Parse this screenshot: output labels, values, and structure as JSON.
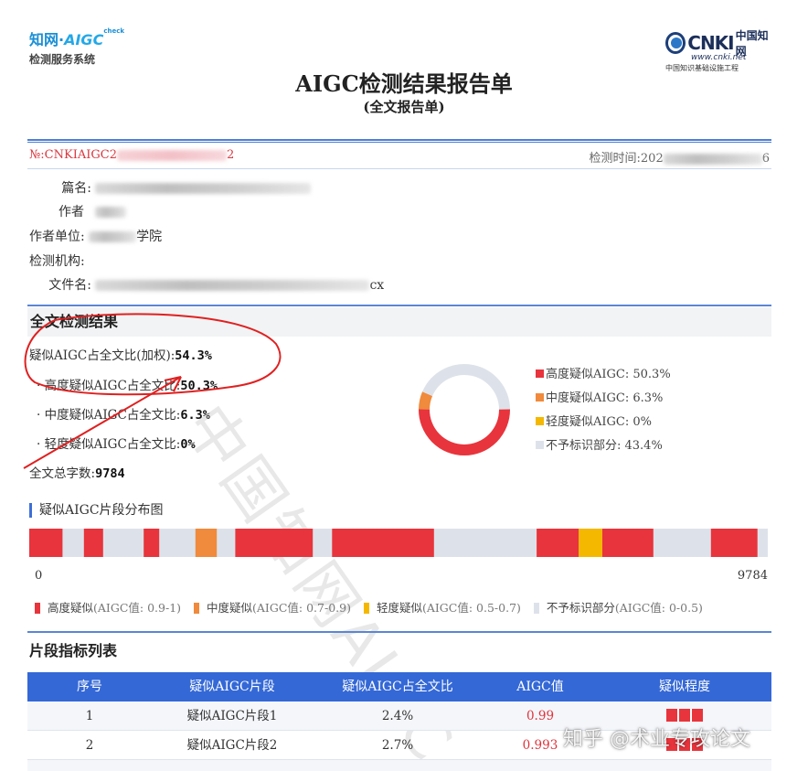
{
  "header": {
    "logo_left_line1_a": "知网·",
    "logo_left_line1_b": "AIGC",
    "logo_left_line1_sup": "check",
    "logo_left_line2": "检测服务系统",
    "logo_right_brand": "CNKI",
    "logo_right_cn": "中国知网",
    "logo_right_url": "www.cnki.net",
    "logo_right_sub": "中国知识基础设施工程",
    "title": "AIGC检测结果报告单",
    "subtitle": "(全文报告单)"
  },
  "meta": {
    "report_no_prefix": "№:CNKIAIGC2",
    "report_no_suffix": "2",
    "time_label": "检测时间:202",
    "time_suffix": "6"
  },
  "info": {
    "title_label": "篇名:",
    "author_label": "作者",
    "unit_label": "作者单位:",
    "unit_value_visible": "学院",
    "org_label": "检测机构:",
    "file_label": "文件名:",
    "file_value_visible": "cx"
  },
  "result": {
    "section_title": "全文检测结果",
    "weighted_label": "疑似AIGC占全文比(加权):",
    "weighted_value": "54.3%",
    "high_label": "· 高度疑似AIGC占全文比:",
    "high_value": "50.3%",
    "mid_label": "· 中度疑似AIGC占全文比:",
    "mid_value": "6.3%",
    "low_label": "· 轻度疑似AIGC占全文比:",
    "low_value": "0%",
    "total_label": "全文总字数:",
    "total_value": "9784"
  },
  "donut_legend": [
    {
      "label": "高度疑似AIGC: 50.3%",
      "color": "#e8343c"
    },
    {
      "label": "中度疑似AIGC: 6.3%",
      "color": "#f08a3c"
    },
    {
      "label": "轻度疑似AIGC: 0%",
      "color": "#f5b800"
    },
    {
      "label": "不予标识部分: 43.4%",
      "color": "#dde2ea"
    }
  ],
  "distribution": {
    "title": "疑似AIGC片段分布图",
    "start": "0",
    "end": "9784",
    "legend": [
      {
        "label": "高度疑似",
        "range": "(AIGC值: 0.9-1)",
        "color": "#e8343c"
      },
      {
        "label": "中度疑似",
        "range": "(AIGC值: 0.7-0.9)",
        "color": "#f08a3c"
      },
      {
        "label": "轻度疑似",
        "range": "(AIGC值: 0.5-0.7)",
        "color": "#f5b800"
      },
      {
        "label": "不予标识部分",
        "range": "(AIGC值: 0-0.5)",
        "color": "#dde2ea"
      }
    ]
  },
  "chart_data": {
    "type": "pie",
    "categories": [
      "高度疑似AIGC",
      "中度疑似AIGC",
      "轻度疑似AIGC",
      "不予标识部分"
    ],
    "values": [
      50.3,
      6.3,
      0,
      43.4
    ],
    "colors": [
      "#e8343c",
      "#f08a3c",
      "#f5b800",
      "#dde2ea"
    ],
    "segments": [
      {
        "start": 0,
        "end": 4.5,
        "level": "high"
      },
      {
        "start": 7.4,
        "end": 10,
        "level": "high"
      },
      {
        "start": 15.5,
        "end": 17.6,
        "level": "high"
      },
      {
        "start": 22.5,
        "end": 25.4,
        "level": "mid"
      },
      {
        "start": 27.9,
        "end": 38.4,
        "level": "high"
      },
      {
        "start": 41,
        "end": 54.8,
        "level": "high"
      },
      {
        "start": 68.7,
        "end": 74.4,
        "level": "high"
      },
      {
        "start": 74.4,
        "end": 77.6,
        "level": "low"
      },
      {
        "start": 77.6,
        "end": 84.5,
        "level": "high"
      },
      {
        "start": 92.3,
        "end": 98.6,
        "level": "high"
      }
    ]
  },
  "table": {
    "section_title": "片段指标列表",
    "headers": [
      "序号",
      "疑似AIGC片段",
      "疑似AIGC占全文比",
      "AIGC值",
      "疑似程度"
    ],
    "rows": [
      [
        "1",
        "疑似AIGC片段1",
        "2.4%",
        "0.99"
      ],
      [
        "2",
        "疑似AIGC片段2",
        "2.7%",
        "0.993"
      ]
    ]
  },
  "watermark": "中国知网AIGC",
  "zhihu_mark": "知乎 @术业专攻论文"
}
